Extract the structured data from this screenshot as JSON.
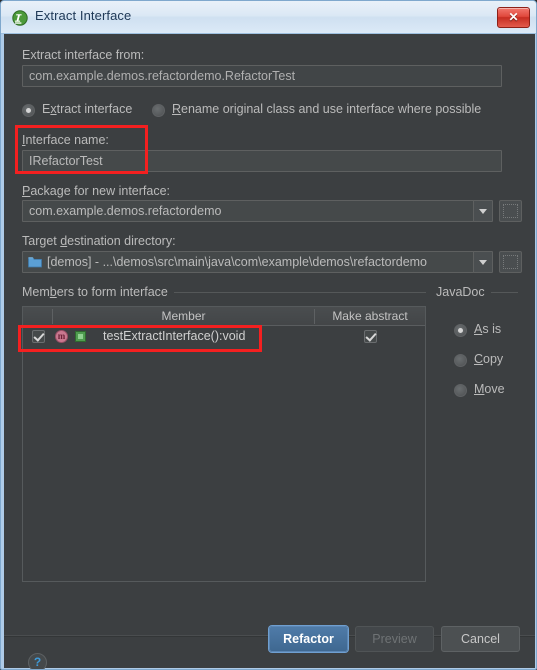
{
  "window": {
    "title": "Extract Interface",
    "icon": "intellij-app-icon",
    "close_label": "✕"
  },
  "form": {
    "extract_from_label": "Extract interface from:",
    "extract_from_value": "com.example.demos.refactordemo.RefactorTest",
    "mode_options": [
      {
        "label_pre": "E",
        "label_mnemonic": "x",
        "label_post": "tract interface",
        "selected": true
      },
      {
        "label_pre": "",
        "label_mnemonic": "R",
        "label_post": "ename original class and use interface where possible",
        "selected": false
      }
    ],
    "interface_name_label_mnemonic": "I",
    "interface_name_label_rest": "nterface name:",
    "interface_name_value": "IRefactorTest",
    "package_label_mnemonic": "P",
    "package_label_rest": "ackage for new interface:",
    "package_value": "com.example.demos.refactordemo",
    "target_dir_label_pre": "Target ",
    "target_dir_label_mnemonic": "d",
    "target_dir_label_post": "estination directory:",
    "target_dir_value": "[demos] - ...\\demos\\src\\main\\java\\com\\example\\demos\\refactordemo",
    "dropdown_icon": "chevron-down-icon",
    "browse_label": "...",
    "folder_icon": "folder-icon"
  },
  "members": {
    "group_label_pre": "Mem",
    "group_label_mnemonic": "b",
    "group_label_post": "ers to form interface",
    "columns": [
      "",
      "Member",
      "Make abstract"
    ],
    "rows": [
      {
        "selected": true,
        "member_icon": "method-icon",
        "visibility_icon": "public-icon",
        "name": "testExtractInterface():void",
        "make_abstract": true
      }
    ]
  },
  "javadoc": {
    "group_label": "JavaDoc",
    "options": [
      {
        "mnemonic": "A",
        "rest": "s is",
        "selected": true
      },
      {
        "mnemonic": "C",
        "rest": "opy",
        "selected": false
      },
      {
        "mnemonic": "M",
        "rest": "ove",
        "selected": false
      }
    ]
  },
  "footer": {
    "help_label": "?",
    "refactor_label": "Refactor",
    "preview_label": "Preview",
    "cancel_label": "Cancel"
  },
  "annotations": {
    "color": "#f42020",
    "boxes": [
      "interface-name-highlight",
      "member-row-highlight"
    ]
  }
}
